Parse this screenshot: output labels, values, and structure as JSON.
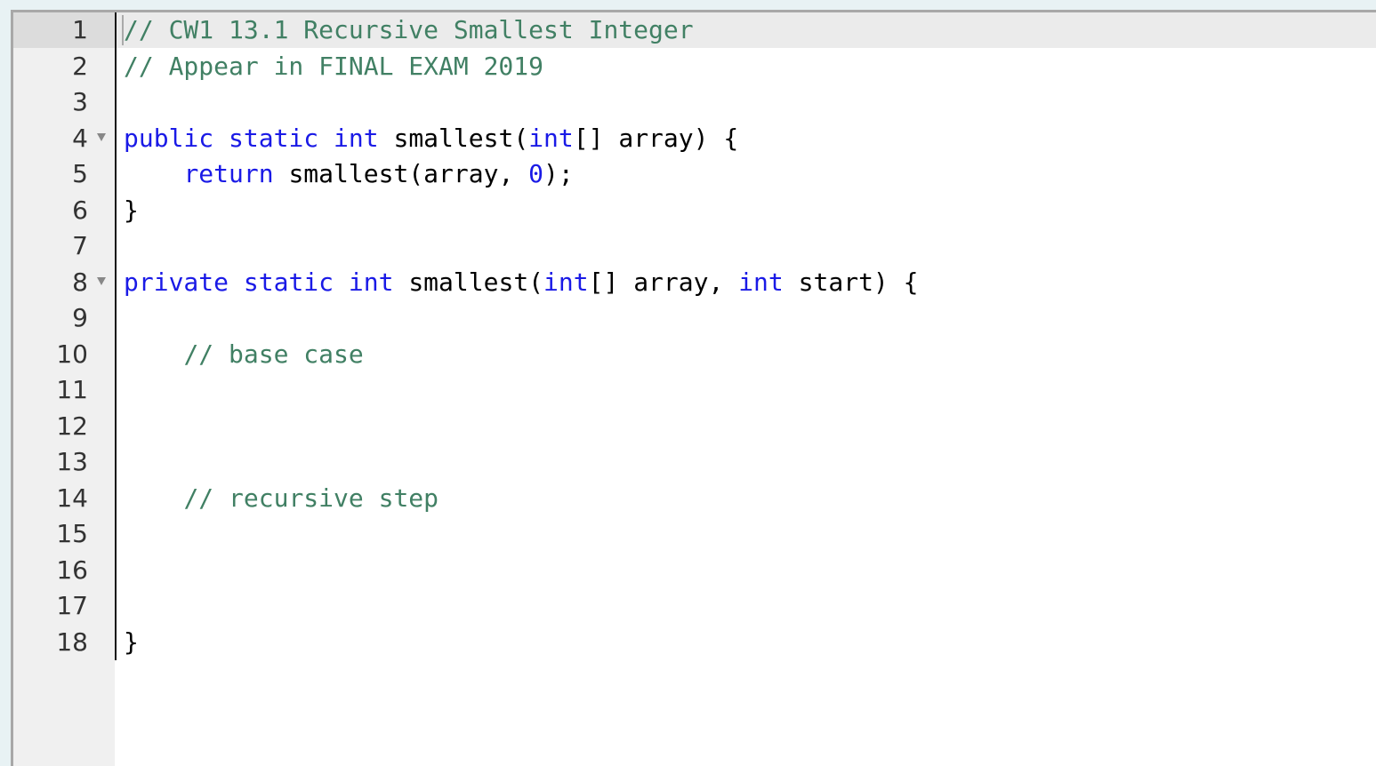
{
  "editor": {
    "language": "java",
    "active_line": 1,
    "colors": {
      "comment": "#418064",
      "keyword": "#1a1ae6",
      "text": "#000000",
      "gutter_bg": "#f0f0f0",
      "page_bg": "#e8f2f4"
    },
    "lines": [
      {
        "n": "1",
        "fold": false,
        "tokens": [
          {
            "t": "cm",
            "v": "// CW1 13.1 Recursive Smallest Integer"
          }
        ]
      },
      {
        "n": "2",
        "fold": false,
        "tokens": [
          {
            "t": "cm",
            "v": "// Appear in FINAL EXAM 2019"
          }
        ]
      },
      {
        "n": "3",
        "fold": false,
        "tokens": []
      },
      {
        "n": "4",
        "fold": true,
        "tokens": [
          {
            "t": "kw",
            "v": "public"
          },
          {
            "t": "tx",
            "v": " "
          },
          {
            "t": "kw",
            "v": "static"
          },
          {
            "t": "tx",
            "v": " "
          },
          {
            "t": "kw",
            "v": "int"
          },
          {
            "t": "tx",
            "v": " smallest("
          },
          {
            "t": "kw",
            "v": "int"
          },
          {
            "t": "tx",
            "v": "[] array) {"
          }
        ]
      },
      {
        "n": "5",
        "fold": false,
        "tokens": [
          {
            "t": "tx",
            "v": "    "
          },
          {
            "t": "kw",
            "v": "return"
          },
          {
            "t": "tx",
            "v": " smallest(array, "
          },
          {
            "t": "num",
            "v": "0"
          },
          {
            "t": "tx",
            "v": ");"
          }
        ]
      },
      {
        "n": "6",
        "fold": false,
        "tokens": [
          {
            "t": "tx",
            "v": "}"
          }
        ]
      },
      {
        "n": "7",
        "fold": false,
        "tokens": []
      },
      {
        "n": "8",
        "fold": true,
        "tokens": [
          {
            "t": "kw",
            "v": "private"
          },
          {
            "t": "tx",
            "v": " "
          },
          {
            "t": "kw",
            "v": "static"
          },
          {
            "t": "tx",
            "v": " "
          },
          {
            "t": "kw",
            "v": "int"
          },
          {
            "t": "tx",
            "v": " smallest("
          },
          {
            "t": "kw",
            "v": "int"
          },
          {
            "t": "tx",
            "v": "[] array, "
          },
          {
            "t": "kw",
            "v": "int"
          },
          {
            "t": "tx",
            "v": " start) {"
          }
        ]
      },
      {
        "n": "9",
        "fold": false,
        "tokens": []
      },
      {
        "n": "10",
        "fold": false,
        "tokens": [
          {
            "t": "tx",
            "v": "    "
          },
          {
            "t": "cm",
            "v": "// base case"
          }
        ]
      },
      {
        "n": "11",
        "fold": false,
        "tokens": []
      },
      {
        "n": "12",
        "fold": false,
        "tokens": []
      },
      {
        "n": "13",
        "fold": false,
        "tokens": []
      },
      {
        "n": "14",
        "fold": false,
        "tokens": [
          {
            "t": "tx",
            "v": "    "
          },
          {
            "t": "cm",
            "v": "// recursive step"
          }
        ]
      },
      {
        "n": "15",
        "fold": false,
        "tokens": []
      },
      {
        "n": "16",
        "fold": false,
        "tokens": []
      },
      {
        "n": "17",
        "fold": false,
        "tokens": []
      },
      {
        "n": "18",
        "fold": false,
        "tokens": [
          {
            "t": "tx",
            "v": "}"
          }
        ]
      }
    ]
  }
}
